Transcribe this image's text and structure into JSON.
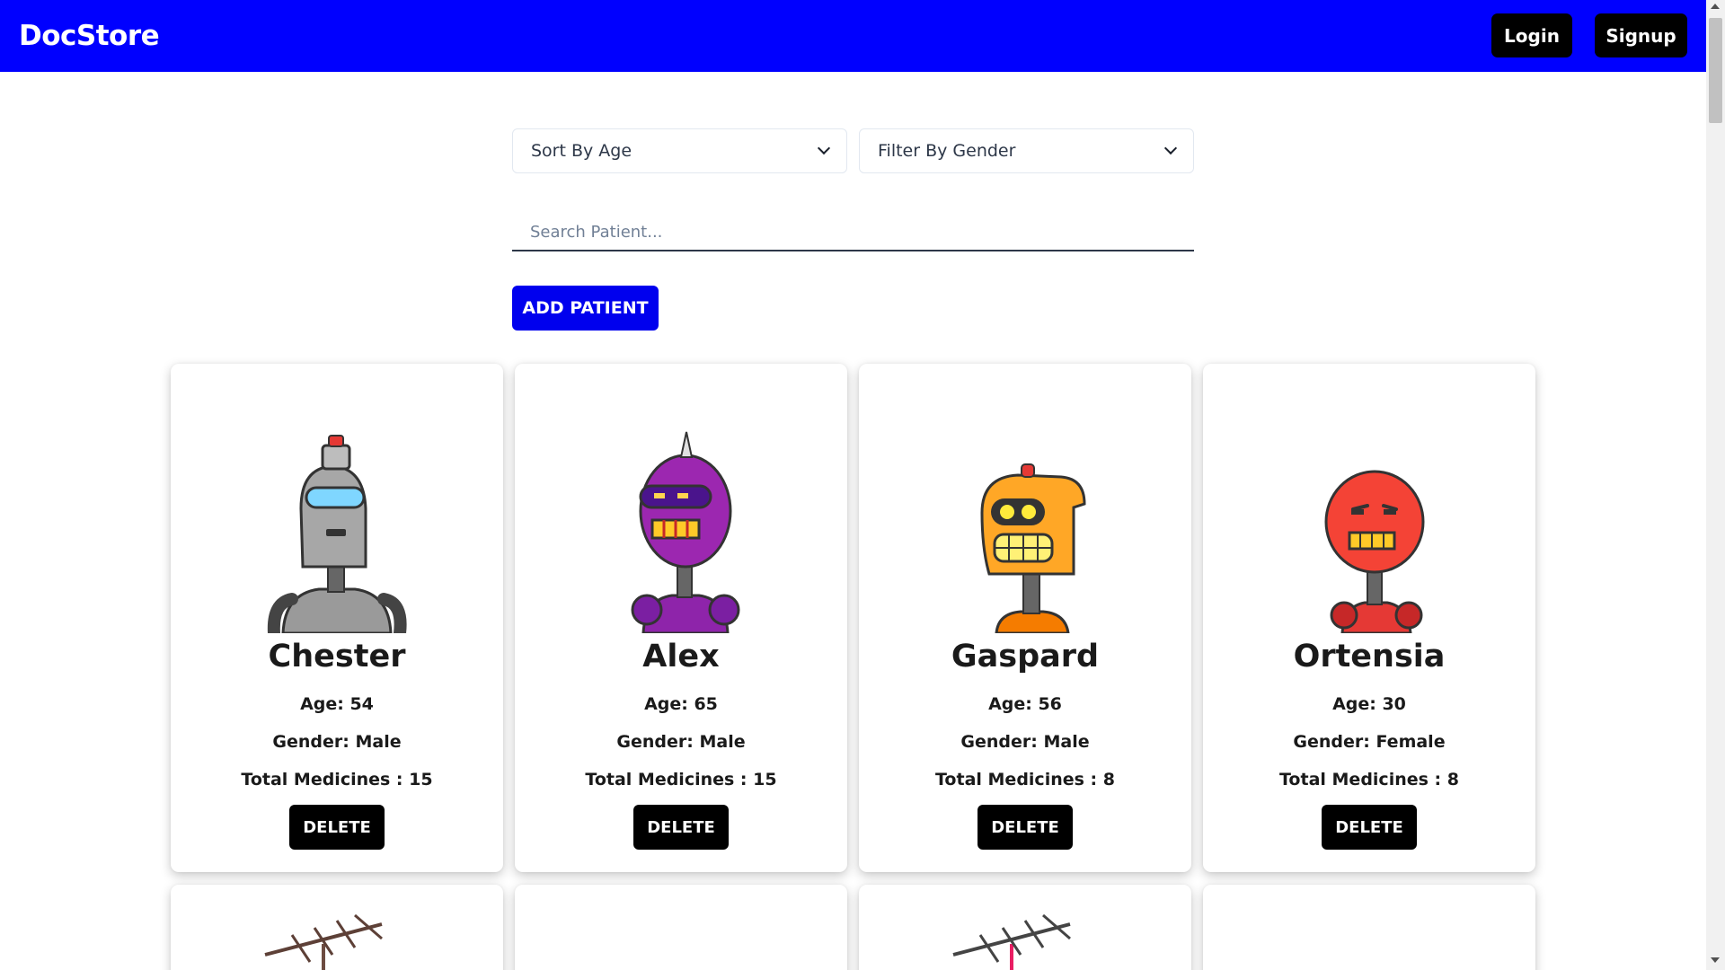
{
  "navbar": {
    "brand": "DocStore",
    "login_label": "Login",
    "signup_label": "Signup",
    "background_color": "#0000ff"
  },
  "controls": {
    "sort_select": "Sort By Age",
    "gender_select": "Filter By Gender",
    "search_placeholder": "Search Patient...",
    "add_patient_label": "ADD PATIENT",
    "add_button_color": "#0000ee"
  },
  "patients": [
    {
      "name": "Chester",
      "age": "Age: 54",
      "gender": "Gender: Male",
      "medicines": "Total Medicines : 15",
      "delete_label": "DELETE",
      "avatar": "grey-robot-icon"
    },
    {
      "name": "Alex",
      "age": "Age: 65",
      "gender": "Gender: Male",
      "medicines": "Total Medicines : 15",
      "delete_label": "DELETE",
      "avatar": "purple-robot-icon"
    },
    {
      "name": "Gaspard",
      "age": "Age: 56",
      "gender": "Gender: Male",
      "medicines": "Total Medicines : 8",
      "delete_label": "DELETE",
      "avatar": "orange-robot-icon"
    },
    {
      "name": "Ortensia",
      "age": "Age: 30",
      "gender": "Gender: Female",
      "medicines": "Total Medicines : 8",
      "delete_label": "DELETE",
      "avatar": "red-robot-icon"
    }
  ]
}
